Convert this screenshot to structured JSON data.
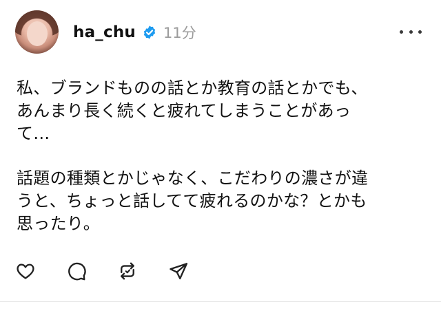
{
  "post": {
    "username": "ha_chu",
    "verified": true,
    "time": "11分",
    "paragraphs": [
      "私、ブランドものの話とか教育の話とかでも、\nあんまり長く続くと疲れてしまうことがあっ\nて…",
      "話題の種類とかじゃなく、こだわりの濃さが違\nうと、ちょっと話してて疲れるのかな？とかも\n思ったり。"
    ]
  },
  "icons": {
    "verified": "verified-badge-icon",
    "more": "more-options-icon",
    "like": "heart-icon",
    "reply": "comment-icon",
    "repost": "repost-icon",
    "share": "send-icon"
  },
  "colors": {
    "verified": "#1d9bf0",
    "time": "#9b9b9b",
    "text": "#111111",
    "icons": "#222222"
  }
}
